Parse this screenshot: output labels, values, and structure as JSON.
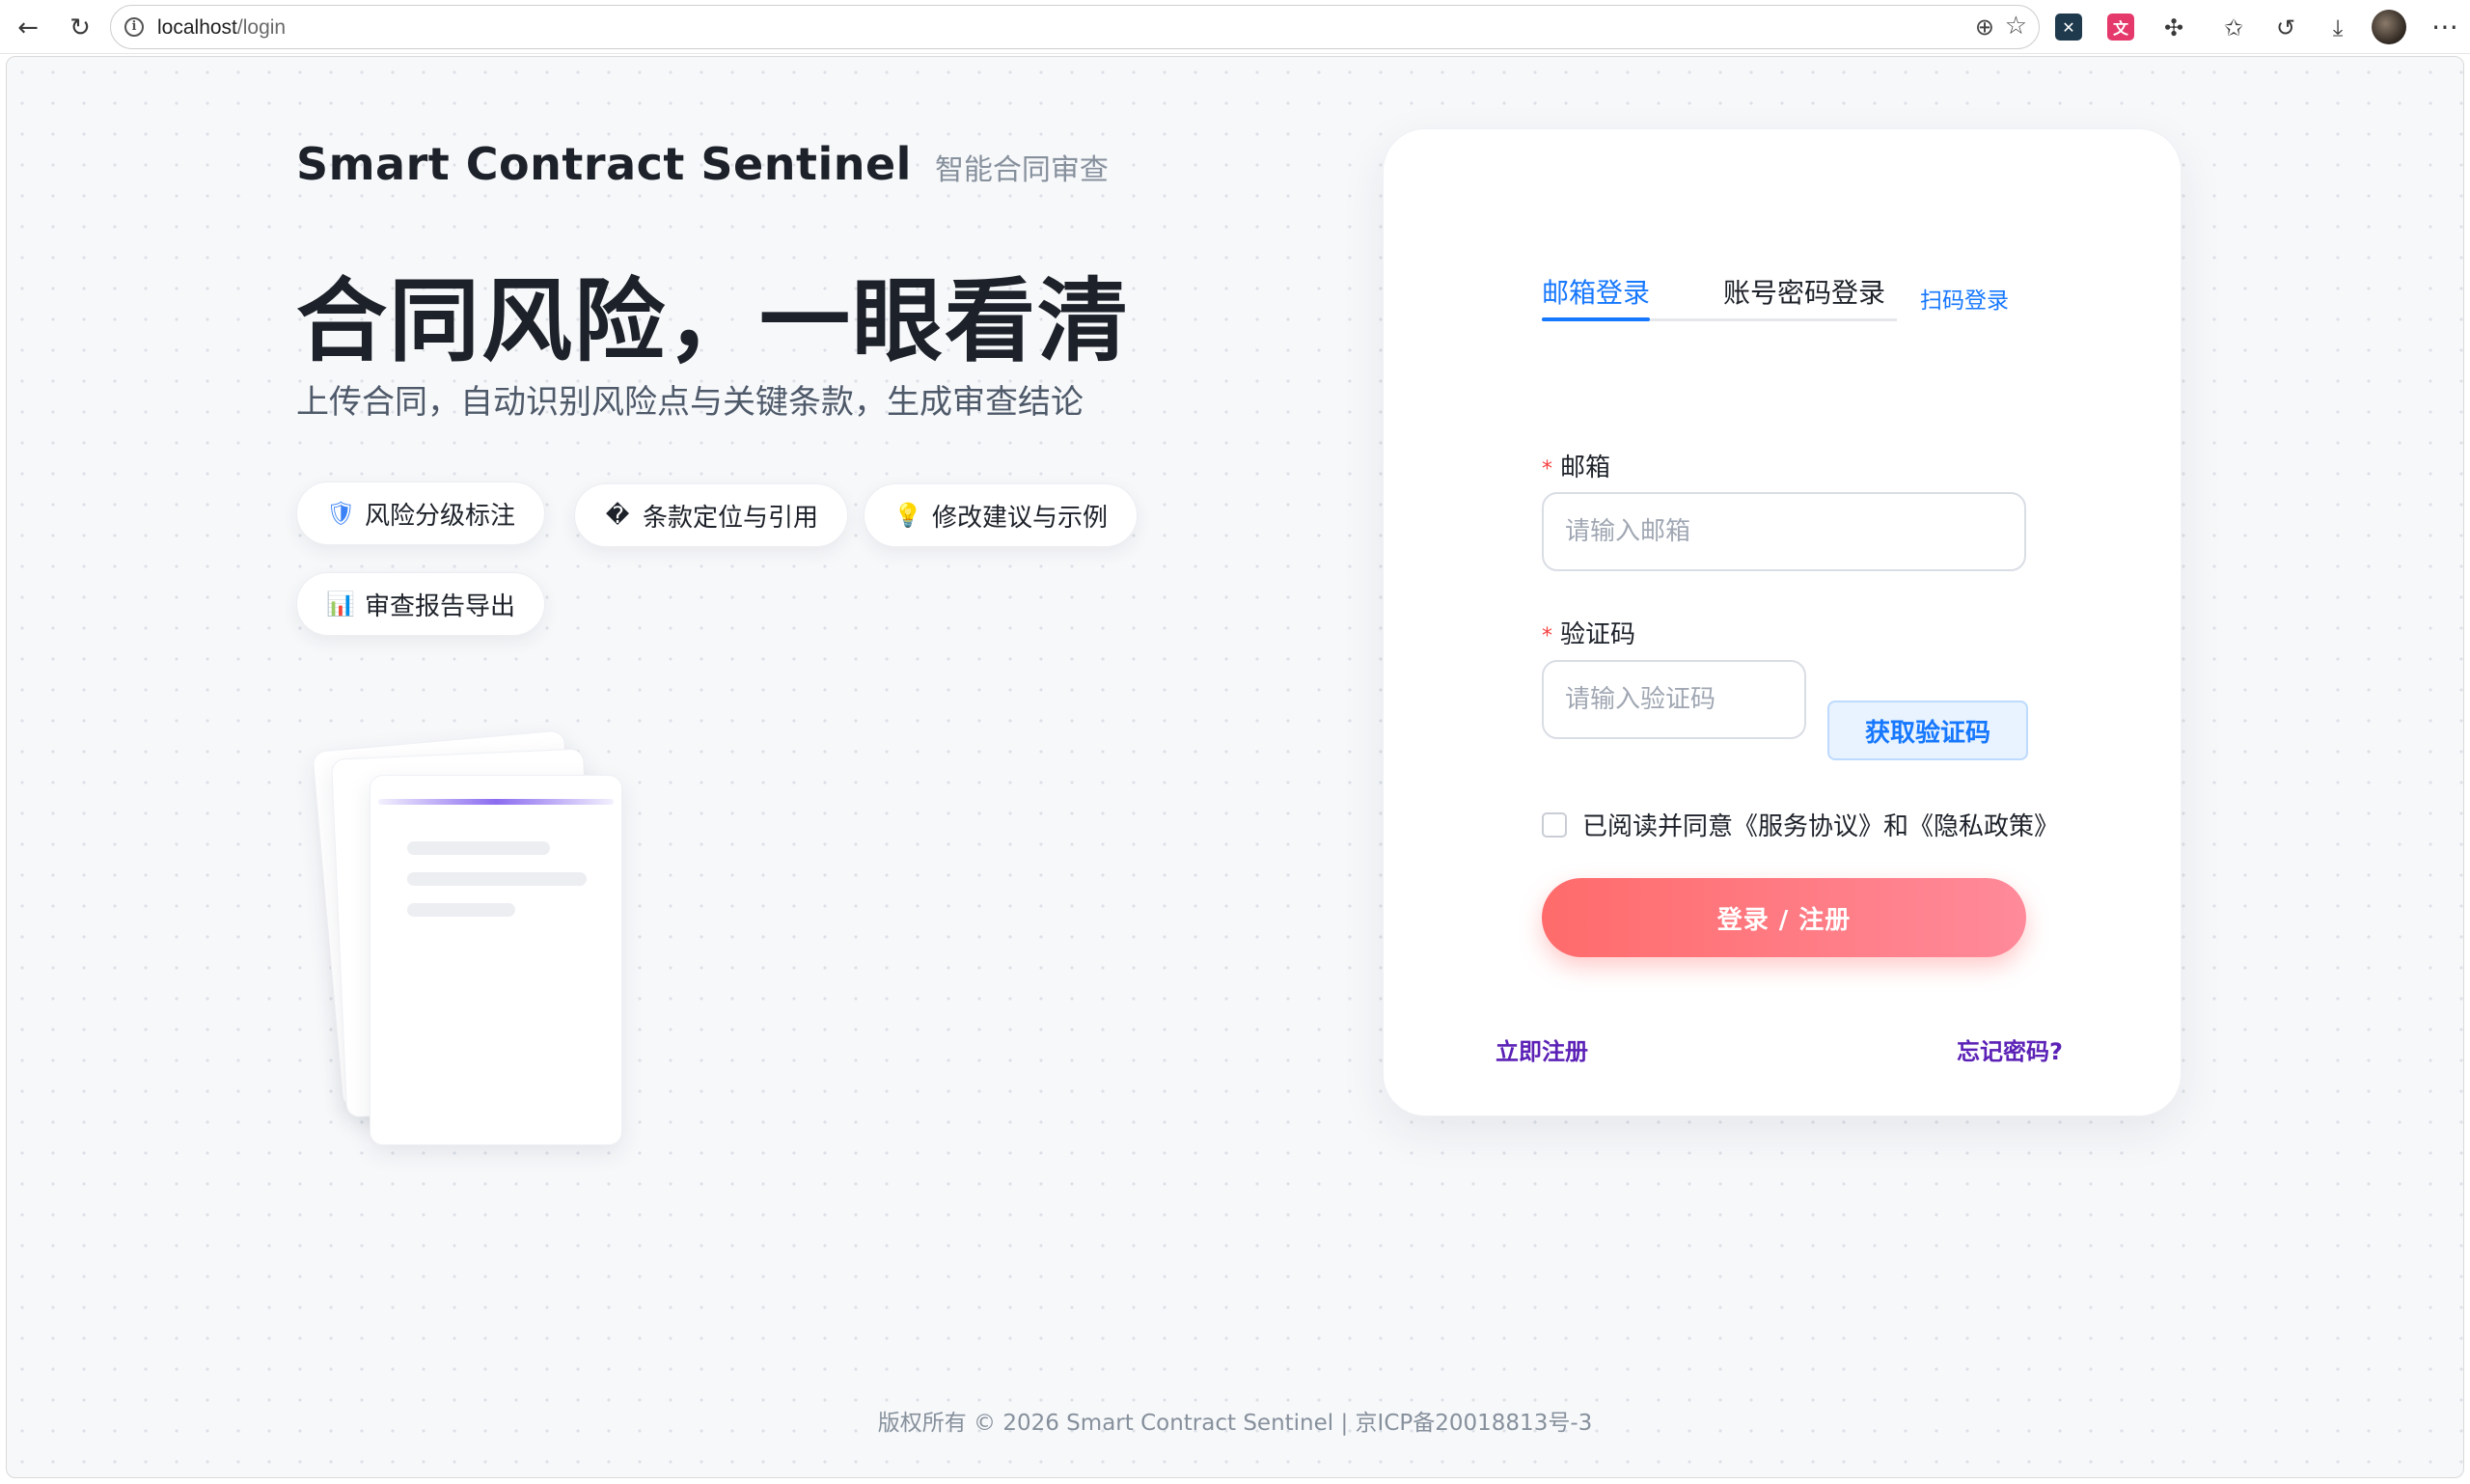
{
  "browser": {
    "url_host": "localhost",
    "url_path": "/login"
  },
  "brand": {
    "name": "Smart Contract Sentinel",
    "subtitle": "智能合同审查"
  },
  "hero": {
    "headline": "合同风险，一眼看清",
    "subline": "上传合同，自动识别风险点与关键条款，生成审查结论"
  },
  "chips": [
    {
      "icon": "🛡",
      "label": "风险分级标注"
    },
    {
      "icon": "�",
      "label": "条款定位与引用"
    },
    {
      "icon": "💡",
      "label": "修改建议与示例"
    },
    {
      "icon": "📊",
      "label": "审查报告导出"
    }
  ],
  "login": {
    "tabs": {
      "email": "邮箱登录",
      "password": "账号密码登录",
      "qr": "扫码登录"
    },
    "email_label": "邮箱",
    "email_placeholder": "请输入邮箱",
    "code_label": "验证码",
    "code_placeholder": "请输入验证码",
    "get_code_button": "获取验证码",
    "agreement": "已阅读并同意《服务协议》和《隐私政策》",
    "submit": "登录 / 注册",
    "register_link": "立即注册",
    "forgot_link": "忘记密码?"
  },
  "footer": {
    "copyright": "版权所有 © 2026 Smart Contract Sentinel | 京ICP备20018813号-3"
  },
  "colors": {
    "primary": "#1677ff",
    "submit_start": "#ff6b6b",
    "submit_end": "#ff8a9a",
    "link": "#5b21b6"
  }
}
